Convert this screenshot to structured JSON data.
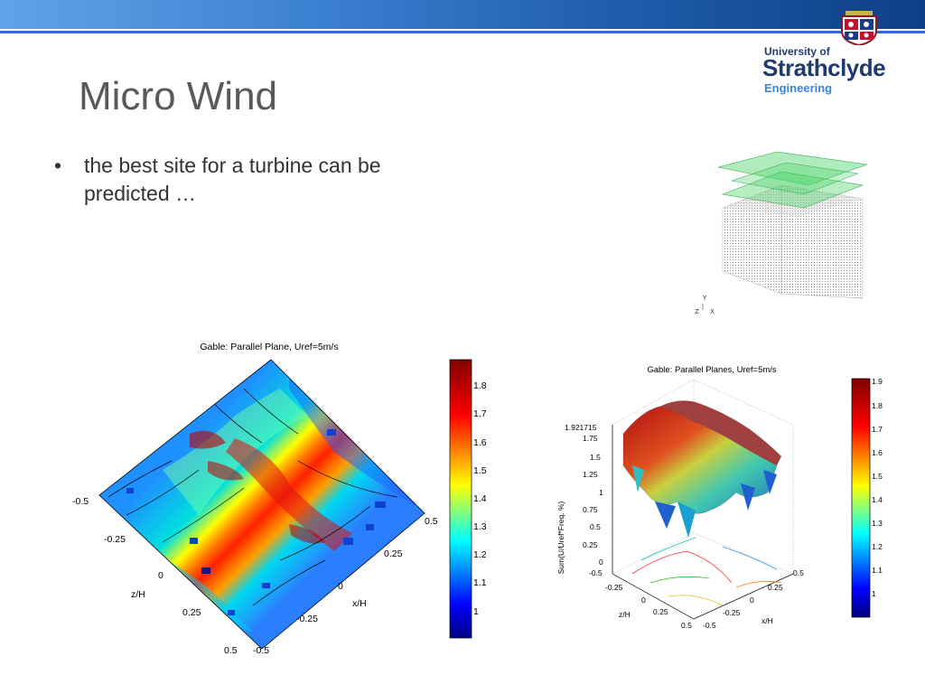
{
  "slide": {
    "title": "Micro Wind",
    "bullet_text": "the best site for a turbine can be predicted …"
  },
  "logo": {
    "line1": "University of",
    "line2": "Strathclyde",
    "line3": "Engineering"
  },
  "house_axes": {
    "y": "Y",
    "z": "Z",
    "x": "X"
  },
  "figure1": {
    "title": "Gable: Parallel Plane, Uref=5m/s",
    "zlabel": "z/H",
    "xlabel": "x/H",
    "z_ticks": [
      "-0.5",
      "-0.25",
      "0",
      "0.25",
      "0.5"
    ],
    "x_ticks": [
      "-0.5",
      "-0.25",
      "0",
      "0.25",
      "0.5"
    ],
    "colorbar_ticks": [
      "1.8",
      "1.7",
      "1.6",
      "1.5",
      "1.4",
      "1.3",
      "1.2",
      "1.1",
      "1"
    ]
  },
  "figure2": {
    "title": "Gable: Parallel Planes, Uref=5m/s",
    "ylabel": "Sum(U/Uref*Freq. %)",
    "zlabel": "z/H",
    "xlabel": "x/H",
    "y_ticks": [
      "1.921715",
      "1.75",
      "1.5",
      "1.25",
      "1",
      "0.75",
      "0.5",
      "0.25",
      "0"
    ],
    "z_ticks": [
      "-0.5",
      "-0.25",
      "0",
      "0.25",
      "0.5"
    ],
    "x_ticks": [
      "-0.5",
      "-0.25",
      "0",
      "0.25",
      "0.5"
    ],
    "colorbar_ticks": [
      "1.9",
      "1.8",
      "1.7",
      "1.6",
      "1.5",
      "1.4",
      "1.3",
      "1.2",
      "1.1",
      "1"
    ]
  }
}
